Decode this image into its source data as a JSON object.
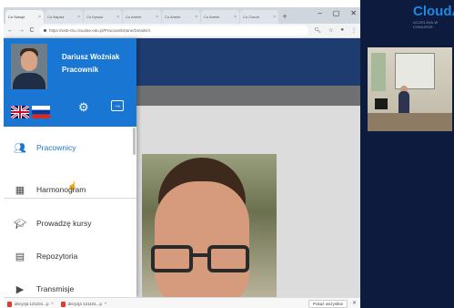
{
  "browser": {
    "tabs": [
      {
        "label": "Co Szkopi",
        "active": true
      },
      {
        "label": "Co Napisz"
      },
      {
        "label": "Co Kysusi"
      },
      {
        "label": "Co Aneim"
      },
      {
        "label": "Co Aneim"
      },
      {
        "label": "Co Aneim"
      },
      {
        "label": "Co Cloudi"
      }
    ],
    "new_tab": "+",
    "window_controls": [
      "–",
      "▢",
      "✕"
    ],
    "url": "https://wsb-nlu.cloudae.edu.pl/PracownikDane/Details/4",
    "back": "←",
    "forward": "→",
    "reload": "C"
  },
  "profile": {
    "name": "Dariusz Woźniak",
    "role": "Pracownik",
    "languages": [
      "english-flag",
      "russian-flag"
    ]
  },
  "nav": [
    {
      "label": "Pracownicy",
      "icon": "people-icon",
      "active": true
    },
    {
      "label": "Harmonogram",
      "icon": "calendar-icon"
    },
    {
      "label": "Prowadzę kursy",
      "icon": "school-icon"
    },
    {
      "label": "Repozytoria",
      "icon": "repository-icon"
    },
    {
      "label": "Transmisje",
      "icon": "play-icon"
    }
  ],
  "downloads": {
    "items": [
      "decyzja 121101...p",
      "decyzja 121101...p"
    ],
    "show_all": "Pokaż wszystkie"
  },
  "brand": {
    "name": "CloudA",
    "tagline": "UCZELNIA W CHMURZE"
  },
  "colors": {
    "accent": "#1976d2",
    "header_dark": "#1f3c70",
    "right_panel": "#0d1b3e"
  }
}
